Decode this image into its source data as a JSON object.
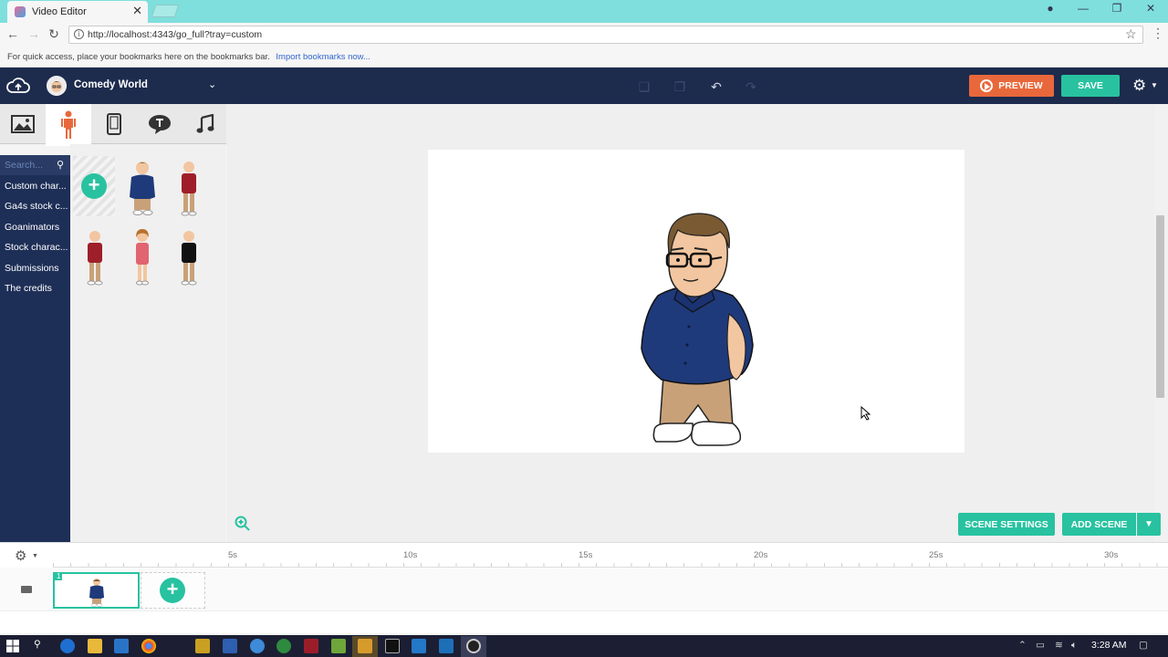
{
  "browser": {
    "tab_title": "Video Editor",
    "url": "http://localhost:4343/go_full?tray=custom",
    "bookmarks_hint": "For quick access, place your bookmarks here on the bookmarks bar.",
    "import_link": "Import bookmarks now..."
  },
  "header": {
    "theme_name": "Comedy World",
    "preview_label": "PREVIEW",
    "save_label": "SAVE"
  },
  "left_panel": {
    "tabs": [
      "backgrounds",
      "characters",
      "props",
      "text",
      "sound"
    ],
    "active_tab": "characters",
    "search_placeholder": "Search...",
    "categories": [
      {
        "label": "Custom char..."
      },
      {
        "label": "Ga4s stock c..."
      },
      {
        "label": "Goanimators"
      },
      {
        "label": "Stock charac..."
      },
      {
        "label": "Submissions"
      },
      {
        "label": "The credits"
      }
    ]
  },
  "stage": {
    "zoom_icon": "zoom-in-icon",
    "scene_settings_label": "SCENE SETTINGS",
    "add_scene_label": "ADD SCENE"
  },
  "timeline": {
    "ticks": [
      "5s",
      "10s",
      "15s",
      "20s",
      "25s",
      "30s"
    ],
    "scene_number": "1"
  },
  "taskbar": {
    "time": "3:28 AM"
  },
  "colors": {
    "accent": "#28c2a0",
    "preview": "#e8683b",
    "header": "#1d2b4d",
    "category_bg": "#1e2f57"
  }
}
